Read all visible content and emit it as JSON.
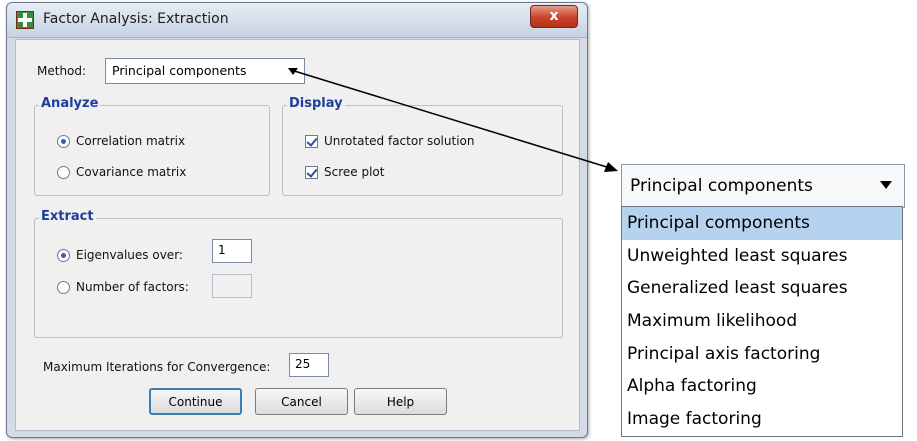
{
  "window": {
    "title": "Factor Analysis: Extraction",
    "close_glyph": "x"
  },
  "method": {
    "label": "Method:",
    "selected": "Principal components"
  },
  "analyze": {
    "title": "Analyze",
    "options": [
      {
        "label": "Correlation matrix",
        "selected": true
      },
      {
        "label": "Covariance matrix",
        "selected": false
      }
    ]
  },
  "display": {
    "title": "Display",
    "options": [
      {
        "label": "Unrotated factor solution",
        "checked": true
      },
      {
        "label": "Scree plot",
        "checked": true
      }
    ]
  },
  "extract": {
    "title": "Extract",
    "eigenvalues": {
      "label": "Eigenvalues over:",
      "value": "1",
      "selected": true
    },
    "num_factors": {
      "label": "Number of factors:",
      "value": "",
      "selected": false
    }
  },
  "max_iter": {
    "label": "Maximum Iterations for Convergence:",
    "value": "25"
  },
  "buttons": {
    "continue": "Continue",
    "cancel": "Cancel",
    "help": "Help"
  },
  "dropdown_callout": {
    "selected": "Principal components",
    "items": [
      "Principal components",
      "Unweighted least squares",
      "Generalized least squares",
      "Maximum likelihood",
      "Principal axis factoring",
      "Alpha factoring",
      "Image factoring"
    ],
    "highlighted_index": 0
  },
  "colors": {
    "group_title": "#1f3e9a",
    "highlight": "#b5d3ef",
    "close_button": "#c7432b"
  }
}
